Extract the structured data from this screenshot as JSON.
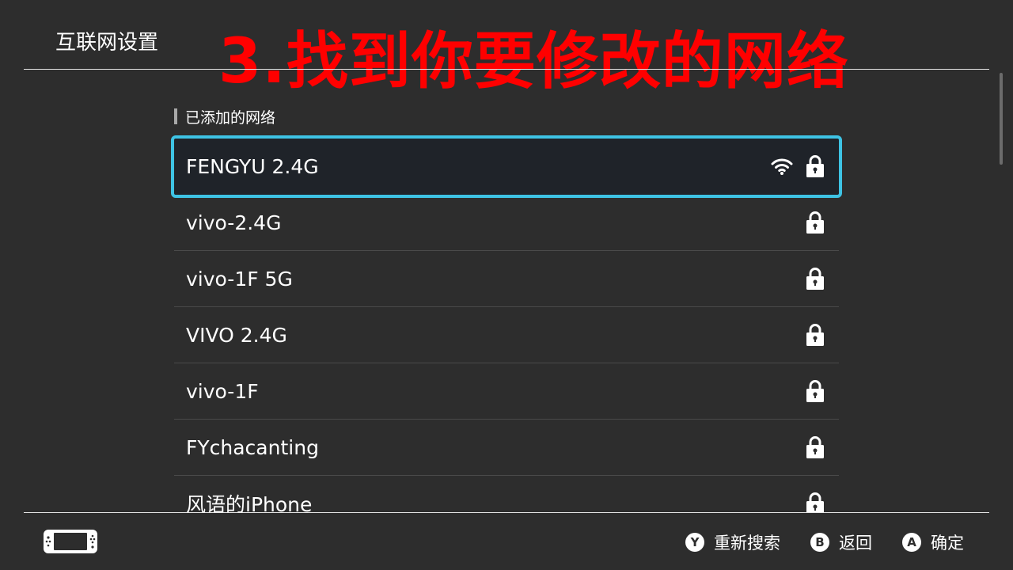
{
  "header": {
    "title": "互联网设置",
    "overlay_caption": "3.找到你要修改的网络"
  },
  "section": {
    "label": "已添加的网络"
  },
  "networks": [
    {
      "name": "FENGYU 2.4G",
      "selected": true,
      "wifi_icon": "wifi-signal-icon",
      "lock_icon": "lock-icon"
    },
    {
      "name": "vivo-2.4G",
      "selected": false,
      "lock_icon": "lock-icon"
    },
    {
      "name": "vivo-1F 5G",
      "selected": false,
      "lock_icon": "lock-icon"
    },
    {
      "name": "VIVO 2.4G",
      "selected": false,
      "lock_icon": "lock-icon"
    },
    {
      "name": "vivo-1F",
      "selected": false,
      "lock_icon": "lock-icon"
    },
    {
      "name": "FYchacanting",
      "selected": false,
      "lock_icon": "lock-icon"
    },
    {
      "name": "风语的iPhone",
      "selected": false,
      "lock_icon": "lock-icon"
    }
  ],
  "footer": {
    "console_icon": "switch-console-icon",
    "actions": [
      {
        "button": "Y",
        "label": "重新搜索"
      },
      {
        "button": "B",
        "label": "返回"
      },
      {
        "button": "A",
        "label": "确定"
      }
    ]
  },
  "colors": {
    "background": "#2d2d2d",
    "selection_border": "#3ec3e4",
    "selection_fill": "#1f2329",
    "caption": "#ff0000",
    "divider": "#4a4a4a"
  }
}
